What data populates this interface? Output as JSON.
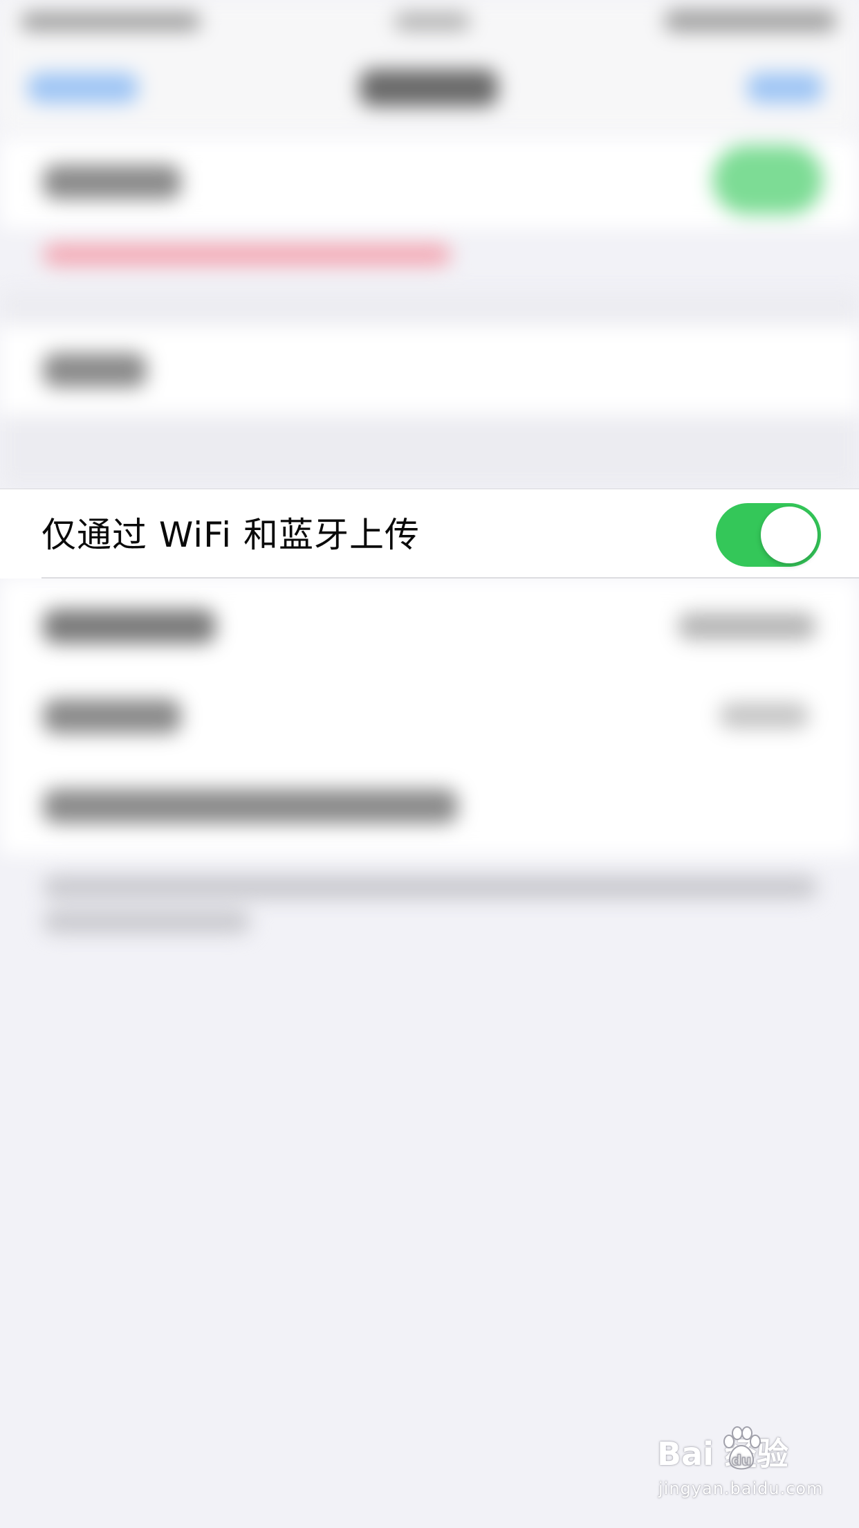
{
  "settings": {
    "row": {
      "label": "仅通过 WiFi 和蓝牙上传",
      "toggle_on": true,
      "toggle_color": "#34c759"
    }
  },
  "watermark": {
    "brand": "Bai   经验",
    "url": "jingyan.baidu.com",
    "icon": "paw-icon"
  }
}
